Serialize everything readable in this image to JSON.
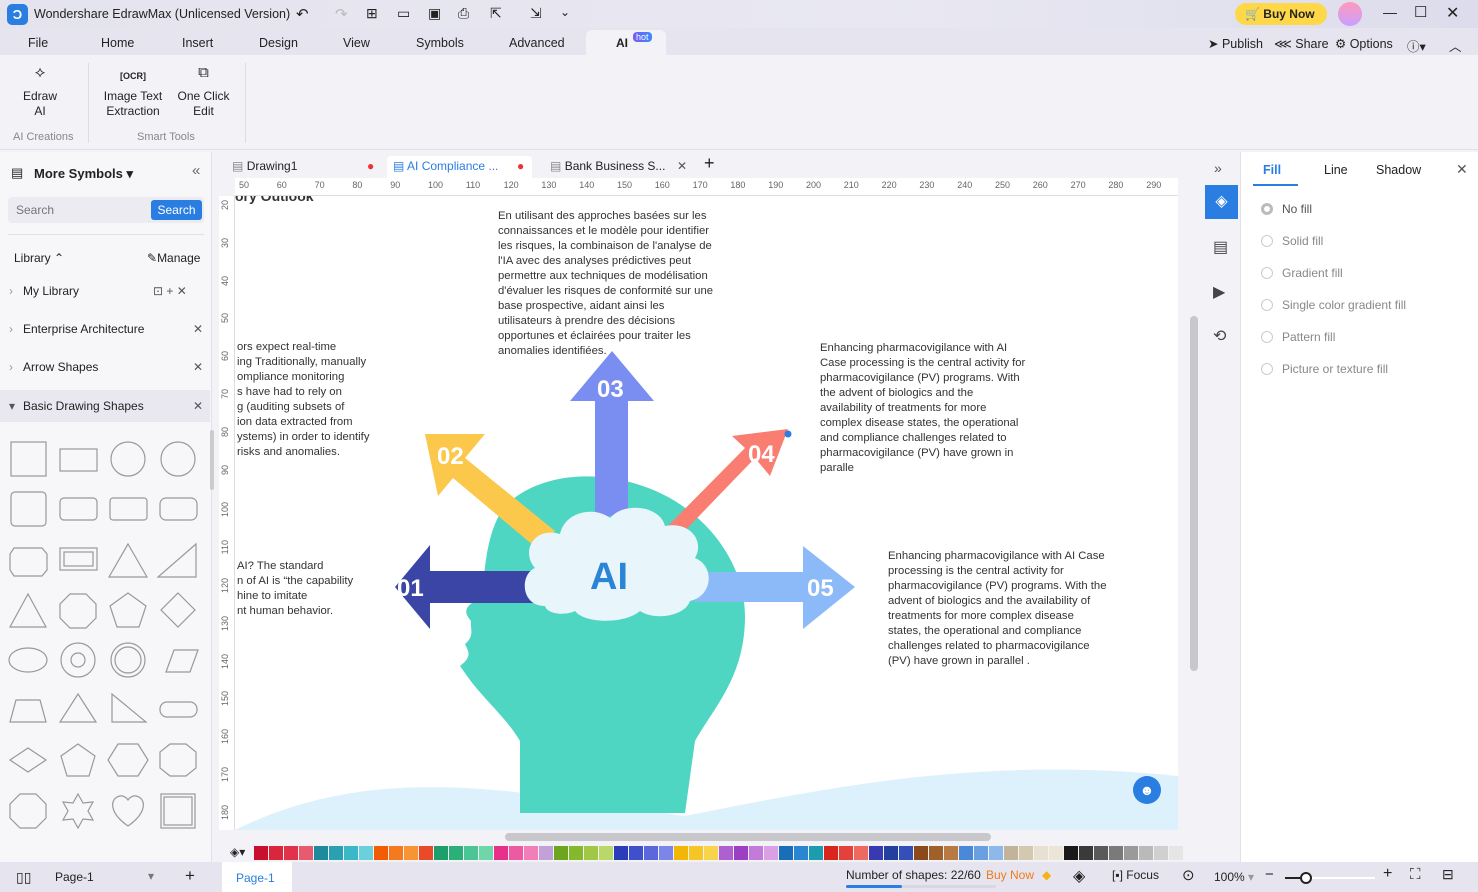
{
  "app": {
    "title": "Wondershare EdrawMax (Unlicensed Version)",
    "buy_now": "Buy Now"
  },
  "menu": {
    "items": [
      "File",
      "Home",
      "Insert",
      "Design",
      "View",
      "Symbols",
      "Advanced",
      "AI"
    ],
    "hot_badge": "hot",
    "publish": "Publish",
    "share": "Share",
    "options": "Options"
  },
  "ribbon": {
    "edraw_ai": [
      "Edraw",
      "AI"
    ],
    "image_text": [
      "Image Text",
      "Extraction"
    ],
    "one_click": [
      "One Click",
      "Edit"
    ],
    "group_ai": "AI Creations",
    "group_smart": "Smart Tools"
  },
  "left_panel": {
    "title": "More Symbols",
    "search_placeholder": "Search",
    "search_button": "Search",
    "library": "Library",
    "manage": "Manage",
    "items": [
      "My Library",
      "Enterprise Architecture",
      "Arrow Shapes",
      "Basic Drawing Shapes"
    ]
  },
  "doc_tabs": [
    {
      "label": "Drawing1"
    },
    {
      "label": "AI Compliance ..."
    },
    {
      "label": "Bank Business S..."
    }
  ],
  "rulers": {
    "h": [
      "50",
      "60",
      "70",
      "80",
      "90",
      "100",
      "110",
      "120",
      "130",
      "140",
      "150",
      "160",
      "170",
      "180",
      "190",
      "200",
      "210",
      "220",
      "230",
      "240",
      "250",
      "260",
      "270",
      "280",
      "290"
    ],
    "v": [
      "20",
      "30",
      "40",
      "50",
      "60",
      "70",
      "80",
      "90",
      "100",
      "110",
      "120",
      "130",
      "140",
      "150",
      "160",
      "170",
      "180"
    ]
  },
  "canvas": {
    "heading_fragment": "ory Outlook",
    "text_left_top": [
      "ors expect real-time",
      "ing Traditionally, manually",
      "ompliance monitoring",
      "s have had to rely on",
      "g (auditing subsets of",
      "ion data extracted from",
      "ystems) in order to identify",
      "risks and anomalies."
    ],
    "text_left_bottom": [
      "AI? The standard",
      "n of AI is “the capability",
      "hine to imitate",
      "nt human behavior."
    ],
    "text_top": [
      "En utilisant des approches basées sur les",
      "connaissances et le modèle pour identifier",
      "les risques, la combinaison de l'analyse de",
      "l'IA avec des analyses prédictives peut",
      "permettre aux techniques de modélisation",
      "d'évaluer les risques de conformité sur une",
      "base prospective, aidant ainsi les",
      "utilisateurs à prendre des décisions",
      "opportunes et éclairées pour traiter les",
      "anomalies identifiées."
    ],
    "text_right_top": [
      "Enhancing pharmacovigilance with AI",
      "Case processing is the central activity for",
      "pharmacovigilance (PV) programs. With",
      "the advent of biologics and the",
      "availability of treatments for more",
      "complex disease states, the operational",
      "and compliance challenges related to",
      "pharmacovigilance (PV) have grown in",
      "paralle"
    ],
    "text_right_bottom": [
      "Enhancing pharmacovigilance with AI Case",
      "processing is the central activity for",
      "pharmacovigilance (PV) programs. With the",
      "advent of biologics and the availability of",
      "treatments for more complex disease",
      "states, the operational and compliance",
      "challenges related to pharmacovigilance",
      "(PV) have grown in parallel ."
    ],
    "center_label": "AI",
    "arrows": [
      {
        "label": "01",
        "color": "#3b45a6"
      },
      {
        "label": "02",
        "color": "#fbc84c"
      },
      {
        "label": "03",
        "color": "#7a8ef2"
      },
      {
        "label": "04",
        "color": "#f97d70"
      },
      {
        "label": "05",
        "color": "#8cbaf8"
      }
    ],
    "head_color": "#4fd6c3",
    "cloud_color": "#e8f6fc",
    "ai_color": "#2b84d6"
  },
  "right_panel": {
    "tabs": [
      "Fill",
      "Line",
      "Shadow"
    ],
    "options": [
      "No fill",
      "Solid fill",
      "Gradient fill",
      "Single color gradient fill",
      "Pattern fill",
      "Picture or texture fill"
    ]
  },
  "status": {
    "page_select": "Page-1",
    "page_tab": "Page-1",
    "shapes": "Number of shapes: 22/60",
    "buy_now": "Buy Now",
    "shapes_progress": 0.37,
    "focus": "Focus",
    "zoom": "100%"
  },
  "palette": [
    "#c8102e",
    "#d9263a",
    "#e0334a",
    "#e85a6e",
    "#1f8a9c",
    "#2aa1b3",
    "#3ab8c8",
    "#6cd0dc",
    "#f25c05",
    "#f47a1f",
    "#f79433",
    "#e84a2a",
    "#1e9e6a",
    "#2bb07a",
    "#4cc494",
    "#6ed6a8",
    "#e6308a",
    "#ee5aa2",
    "#f27eb8",
    "#c2a0d8",
    "#6ea51e",
    "#86b82c",
    "#a0c844",
    "#b8d86a",
    "#2c3cb8",
    "#3f50cc",
    "#5a68dc",
    "#7c86e8",
    "#f2b705",
    "#f5c626",
    "#f8d44c",
    "#b05fd0",
    "#9d3fc2",
    "#c47ad8",
    "#d9a0e6",
    "#1a6db8",
    "#2a86d0",
    "#1d9cb0",
    "#d8261c",
    "#e4413a",
    "#ee6a60",
    "#3a3ab0",
    "#24409e",
    "#3450b8",
    "#8a4a1c",
    "#a0602a",
    "#b87a40",
    "#4a88d8",
    "#6aa0e0",
    "#8cb8ea",
    "#c2b49a",
    "#d4c8b0",
    "#e8e0d0",
    "#ebe6d8",
    "#1a1a1a",
    "#3a3a3a",
    "#5a5a5a",
    "#7a7a7a",
    "#9a9a9a",
    "#bababa",
    "#d0d0d0",
    "#e6e6e6"
  ]
}
